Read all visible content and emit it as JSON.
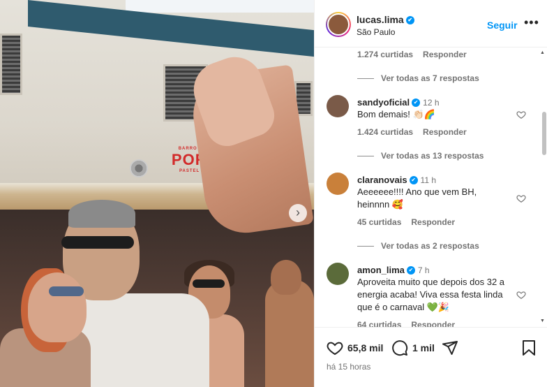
{
  "photo": {
    "sign_small": "BARRO FUNDO · SÃO PAULO",
    "sign_name": "POR AMOR",
    "sign_sub": "PASTEL · ACAPIRA · BRASA",
    "next_icon": "chevron-right-icon"
  },
  "post": {
    "author": "lucas.lima",
    "location": "São Paulo",
    "follow_label": "Seguir",
    "more_icon": "more-horizontal-icon",
    "verified_icon": "✔"
  },
  "comments": [
    {
      "meta_likes": "1.274 curtidas",
      "reply_label": "Responder",
      "see_replies": "Ver todas as 7 respostas"
    },
    {
      "user": "sandyoficial",
      "time": "12 h",
      "text": "Bom demais! 👏🏻🌈",
      "likes": "1.424 curtidas",
      "reply_label": "Responder",
      "see_replies": "Ver todas as 13 respostas",
      "avatar_color": "#7a5a48"
    },
    {
      "user": "claranovais",
      "time": "11 h",
      "text": "Aeeeeee!!!! Ano que vem BH, heinnnn 🥰",
      "likes": "45 curtidas",
      "reply_label": "Responder",
      "see_replies": "Ver todas as 2 respostas",
      "avatar_color": "#c9803a"
    },
    {
      "user": "amon_lima",
      "time": "7 h",
      "text": "Aproveita muito que depois dos 32 a energia acaba! Viva essa festa linda que é o carnaval 💚🎉",
      "likes": "64 curtidas",
      "reply_label": "Responder",
      "avatar_color": "#5b6b3a"
    }
  ],
  "actions": {
    "likes": "65,8 mil",
    "comments": "1 mil",
    "time_ago": "há 15 horas"
  },
  "colors": {
    "accent": "#0095f6",
    "secondary_text": "#737373",
    "primary_text": "#262626"
  }
}
